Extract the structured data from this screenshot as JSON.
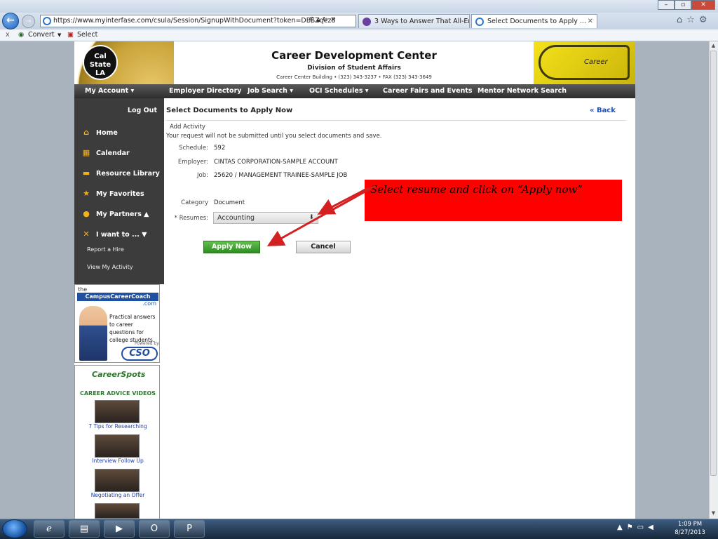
{
  "browser": {
    "url": "https://www.myinterfase.com/csula/Session/SignupWithDocument?token=DBSZqez8",
    "tabs": [
      {
        "label": "3 Ways to Answer That All-Enc..."
      },
      {
        "label": "Select Documents to Apply ..."
      }
    ],
    "window_controls": {
      "minimize": "–",
      "maximize": "▫",
      "close": "✕"
    },
    "command_bar": {
      "close": "x",
      "convert": "Convert",
      "select": "Select"
    }
  },
  "header": {
    "logo_text": "Cal State LA",
    "title": "Career Development Center",
    "subtitle": "Division of Student Affairs",
    "address": "Career Center Building  •  (323) 343-3237  •  FAX (323) 343-3649",
    "badge": "Career Center"
  },
  "menu": [
    {
      "label": "My Account ▾"
    },
    {
      "label": "Employer Directory"
    },
    {
      "label": "Job Search ▾"
    },
    {
      "label": "OCI Schedules ▾"
    },
    {
      "label": "Career Fairs and Events"
    },
    {
      "label": "Mentor Network Search"
    }
  ],
  "sidebar": {
    "logout": "Log Out",
    "items": [
      {
        "label": "Home",
        "icon": "home-icon",
        "glyph": "⌂"
      },
      {
        "label": "Calendar",
        "icon": "calendar-icon",
        "glyph": "▦"
      },
      {
        "label": "Resource Library",
        "icon": "folder-icon",
        "glyph": "▬"
      },
      {
        "label": "My Favorites",
        "icon": "star-icon",
        "glyph": "★"
      },
      {
        "label": "My Partners  ▲",
        "icon": "person-icon",
        "glyph": "●"
      },
      {
        "label": "I want to ...  ▼",
        "icon": "tools-icon",
        "glyph": "✕"
      }
    ],
    "subitems": [
      {
        "label": "Report a Hire"
      },
      {
        "label": "View My Activity"
      }
    ]
  },
  "coach_ad": {
    "brand_top": "the",
    "brand": "CampusCareerCoach",
    "brand_suffix": ".com",
    "text": "Practical answers to career questions for college students.",
    "powered": "Powered by",
    "powered_brand": "CSO"
  },
  "career_spots": {
    "brand": "CareerSpots",
    "heading": "CAREER ADVICE VIDEOS",
    "videos": [
      {
        "caption": "7 Tips for Researching"
      },
      {
        "caption": "Interview Follow Up"
      },
      {
        "caption": "Negotiating an Offer"
      }
    ]
  },
  "content": {
    "title": "Select Documents to Apply Now",
    "back": "« Back",
    "section": "Add Activity",
    "notice": "Your request will not be submitted until you select documents and save.",
    "fields": [
      {
        "label": "Schedule:",
        "value": "592"
      },
      {
        "label": "Employer:",
        "value": "CINTAS CORPORATION-SAMPLE ACCOUNT"
      },
      {
        "label": "Job:",
        "value": "25620 / MANAGEMENT TRAINEE-SAMPLE JOB"
      }
    ],
    "category_label": "Category",
    "category_value": "Document",
    "resumes_label": "* Resumes:",
    "resumes_value": "Accounting",
    "apply_label": "Apply Now",
    "cancel_label": "Cancel"
  },
  "annotation": {
    "callout": "Select resume and click on “Apply now”",
    "arrow_color": "#d42020",
    "callout_color": "#ff0000"
  },
  "taskbar": {
    "time": "1:09 PM",
    "date": "8/27/2013"
  },
  "colors": {
    "menu_bg": "#2d2d2d",
    "sidebar_bg": "#3c3c3c",
    "apply_green": "#2e8c24",
    "link_blue": "#1b4fc2"
  }
}
